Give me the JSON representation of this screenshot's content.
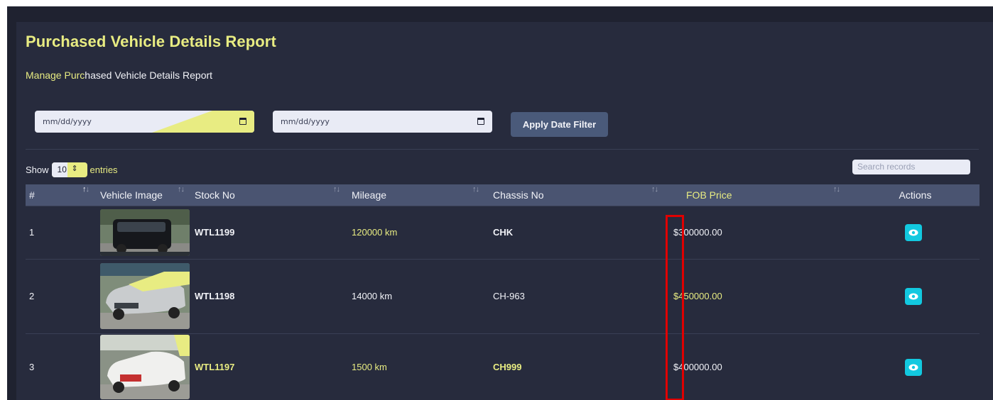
{
  "page": {
    "title": "Purchased Vehicle Details Report",
    "subtitle_highlight": "Manage Purc",
    "subtitle_rest": "hased Vehicle Details Report"
  },
  "filters": {
    "start_date_placeholder": "mm/dd/yyyy",
    "end_date_placeholder": "mm/dd/yyyy",
    "apply_label": "Apply Date Filter"
  },
  "table_controls": {
    "show_label": "Show",
    "entries_value": "10",
    "entries_label": "entries",
    "search_placeholder": "Search records"
  },
  "table": {
    "columns": [
      "#",
      "Vehicle Image",
      "Stock No",
      "Mileage",
      "Chassis No",
      "FOB Price",
      "Actions"
    ],
    "rows": [
      {
        "num": "1",
        "stock": "WTL1199",
        "mileage": "120000 km",
        "chassis": "CHK",
        "price": "$300000.00",
        "image": "black-minivan"
      },
      {
        "num": "2",
        "stock": "WTL1198",
        "mileage": "14000 km",
        "chassis": "CH-963",
        "price": "$450000.00",
        "image": "silver-wagon"
      },
      {
        "num": "3",
        "stock": "WTL1197",
        "mileage": "1500 km",
        "chassis": "CH999",
        "price": "$400000.00",
        "image": "white-wagon"
      }
    ]
  },
  "colors": {
    "accent": "#e8ec82",
    "background": "#272b3d",
    "header_row": "#4a5471",
    "action_button": "#12c9e0",
    "highlight_box": "#e00000"
  },
  "icons": {
    "view": "eye-icon",
    "calendar": "calendar-icon",
    "sort": "sort-arrows-icon",
    "stepper": "stepper-arrows-icon"
  }
}
